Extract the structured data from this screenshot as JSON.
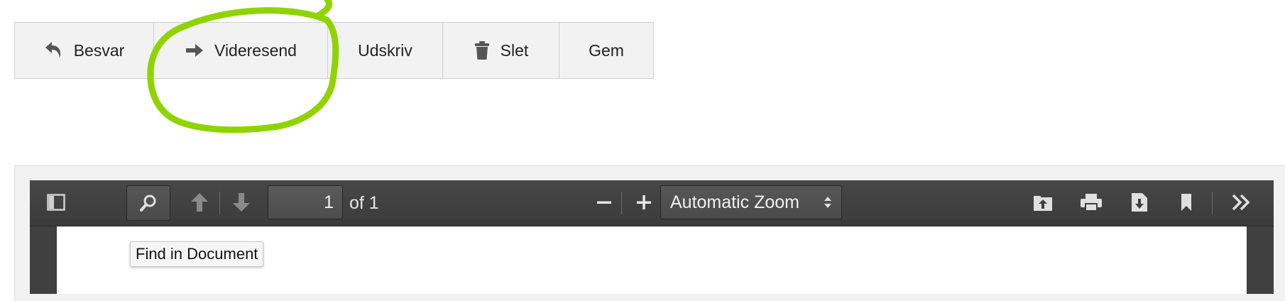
{
  "actions": {
    "reply_label": "Besvar",
    "forward_label": "Videresend",
    "print_label": "Udskriv",
    "delete_label": "Slet",
    "save_label": "Gem"
  },
  "annotation": {
    "color": "#8fd400"
  },
  "pdf_viewer": {
    "page_number": "1",
    "page_count": "of 1",
    "zoom": "Automatic Zoom",
    "tooltip": "Find in Document"
  }
}
